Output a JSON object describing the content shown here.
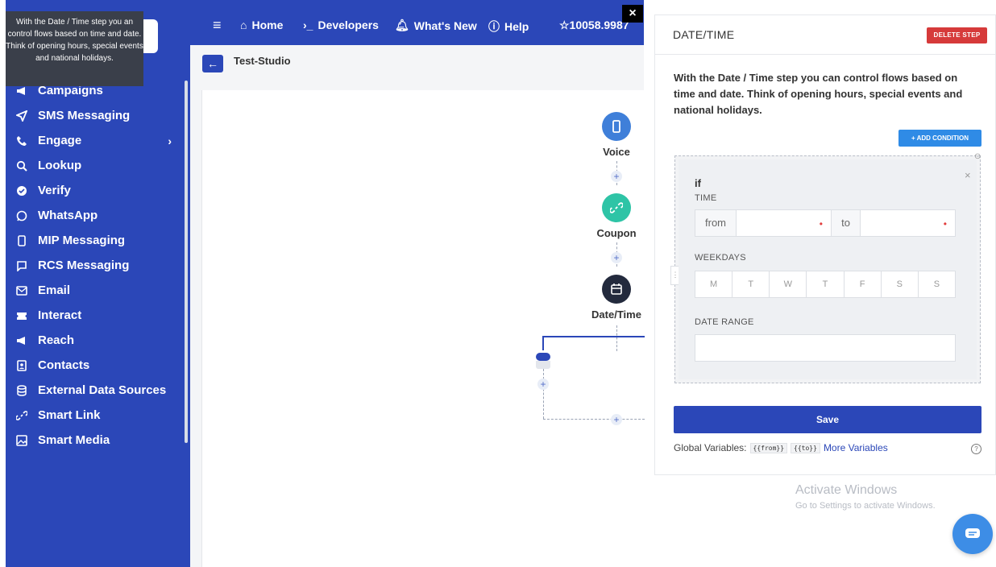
{
  "tooltip": {
    "text": "With the Date / Time step you an control flows based on time and date. Think of opening hours, special events and national holidays."
  },
  "sidebar": {
    "items": [
      {
        "label": "Campaigns",
        "icon": "megaphone-icon"
      },
      {
        "label": "SMS Messaging",
        "icon": "send-icon"
      },
      {
        "label": "Engage",
        "icon": "phone-icon",
        "has_submenu": true
      },
      {
        "label": "Lookup",
        "icon": "search-icon"
      },
      {
        "label": "Verify",
        "icon": "badge-icon"
      },
      {
        "label": "WhatsApp",
        "icon": "whatsapp-icon"
      },
      {
        "label": "MIP Messaging",
        "icon": "mobile-icon"
      },
      {
        "label": "RCS Messaging",
        "icon": "chat-icon"
      },
      {
        "label": "Email",
        "icon": "mail-icon"
      },
      {
        "label": "Interact",
        "icon": "ticket-icon"
      },
      {
        "label": "Reach",
        "icon": "megaphone-icon"
      },
      {
        "label": "Contacts",
        "icon": "contacts-icon"
      },
      {
        "label": "External Data Sources",
        "icon": "database-icon"
      },
      {
        "label": "Smart Link",
        "icon": "link-icon"
      },
      {
        "label": "Smart Media",
        "icon": "image-icon"
      }
    ]
  },
  "topbar": {
    "home": "Home",
    "developers": "Developers",
    "whats_new": "What's New",
    "help": "Help",
    "credits": "☆10058.9987",
    "close": "×"
  },
  "breadcrumb": {
    "title": "Test-Studio"
  },
  "flow": {
    "nodes": [
      {
        "label": "Voice",
        "color": "#3f7fd9"
      },
      {
        "label": "Coupon",
        "color": "#2ec4a6"
      },
      {
        "label": "Date/Time",
        "color": "#232a3d"
      }
    ]
  },
  "panel": {
    "title": "DATE/TIME",
    "delete_label": "DELETE STEP",
    "description": "With the Date / Time step you can control flows based on time and date. Think of opening hours, special events and national holidays.",
    "add_condition_label": "+ ADD CONDITION",
    "condition": {
      "if_label": "if",
      "time_label": "TIME",
      "from_label": "from",
      "to_label": "to",
      "weekdays_label": "WEEKDAYS",
      "weekdays": [
        "M",
        "T",
        "W",
        "T",
        "F",
        "S",
        "S"
      ],
      "date_range_label": "DATE RANGE"
    },
    "save_label": "Save",
    "globals_label": "Global Variables:",
    "var_from": "{{from}}",
    "var_to": "{{to}}",
    "more_variables": "More Variables"
  },
  "watermark": {
    "line1": "Activate Windows",
    "line2": "Go to Settings to activate Windows."
  }
}
